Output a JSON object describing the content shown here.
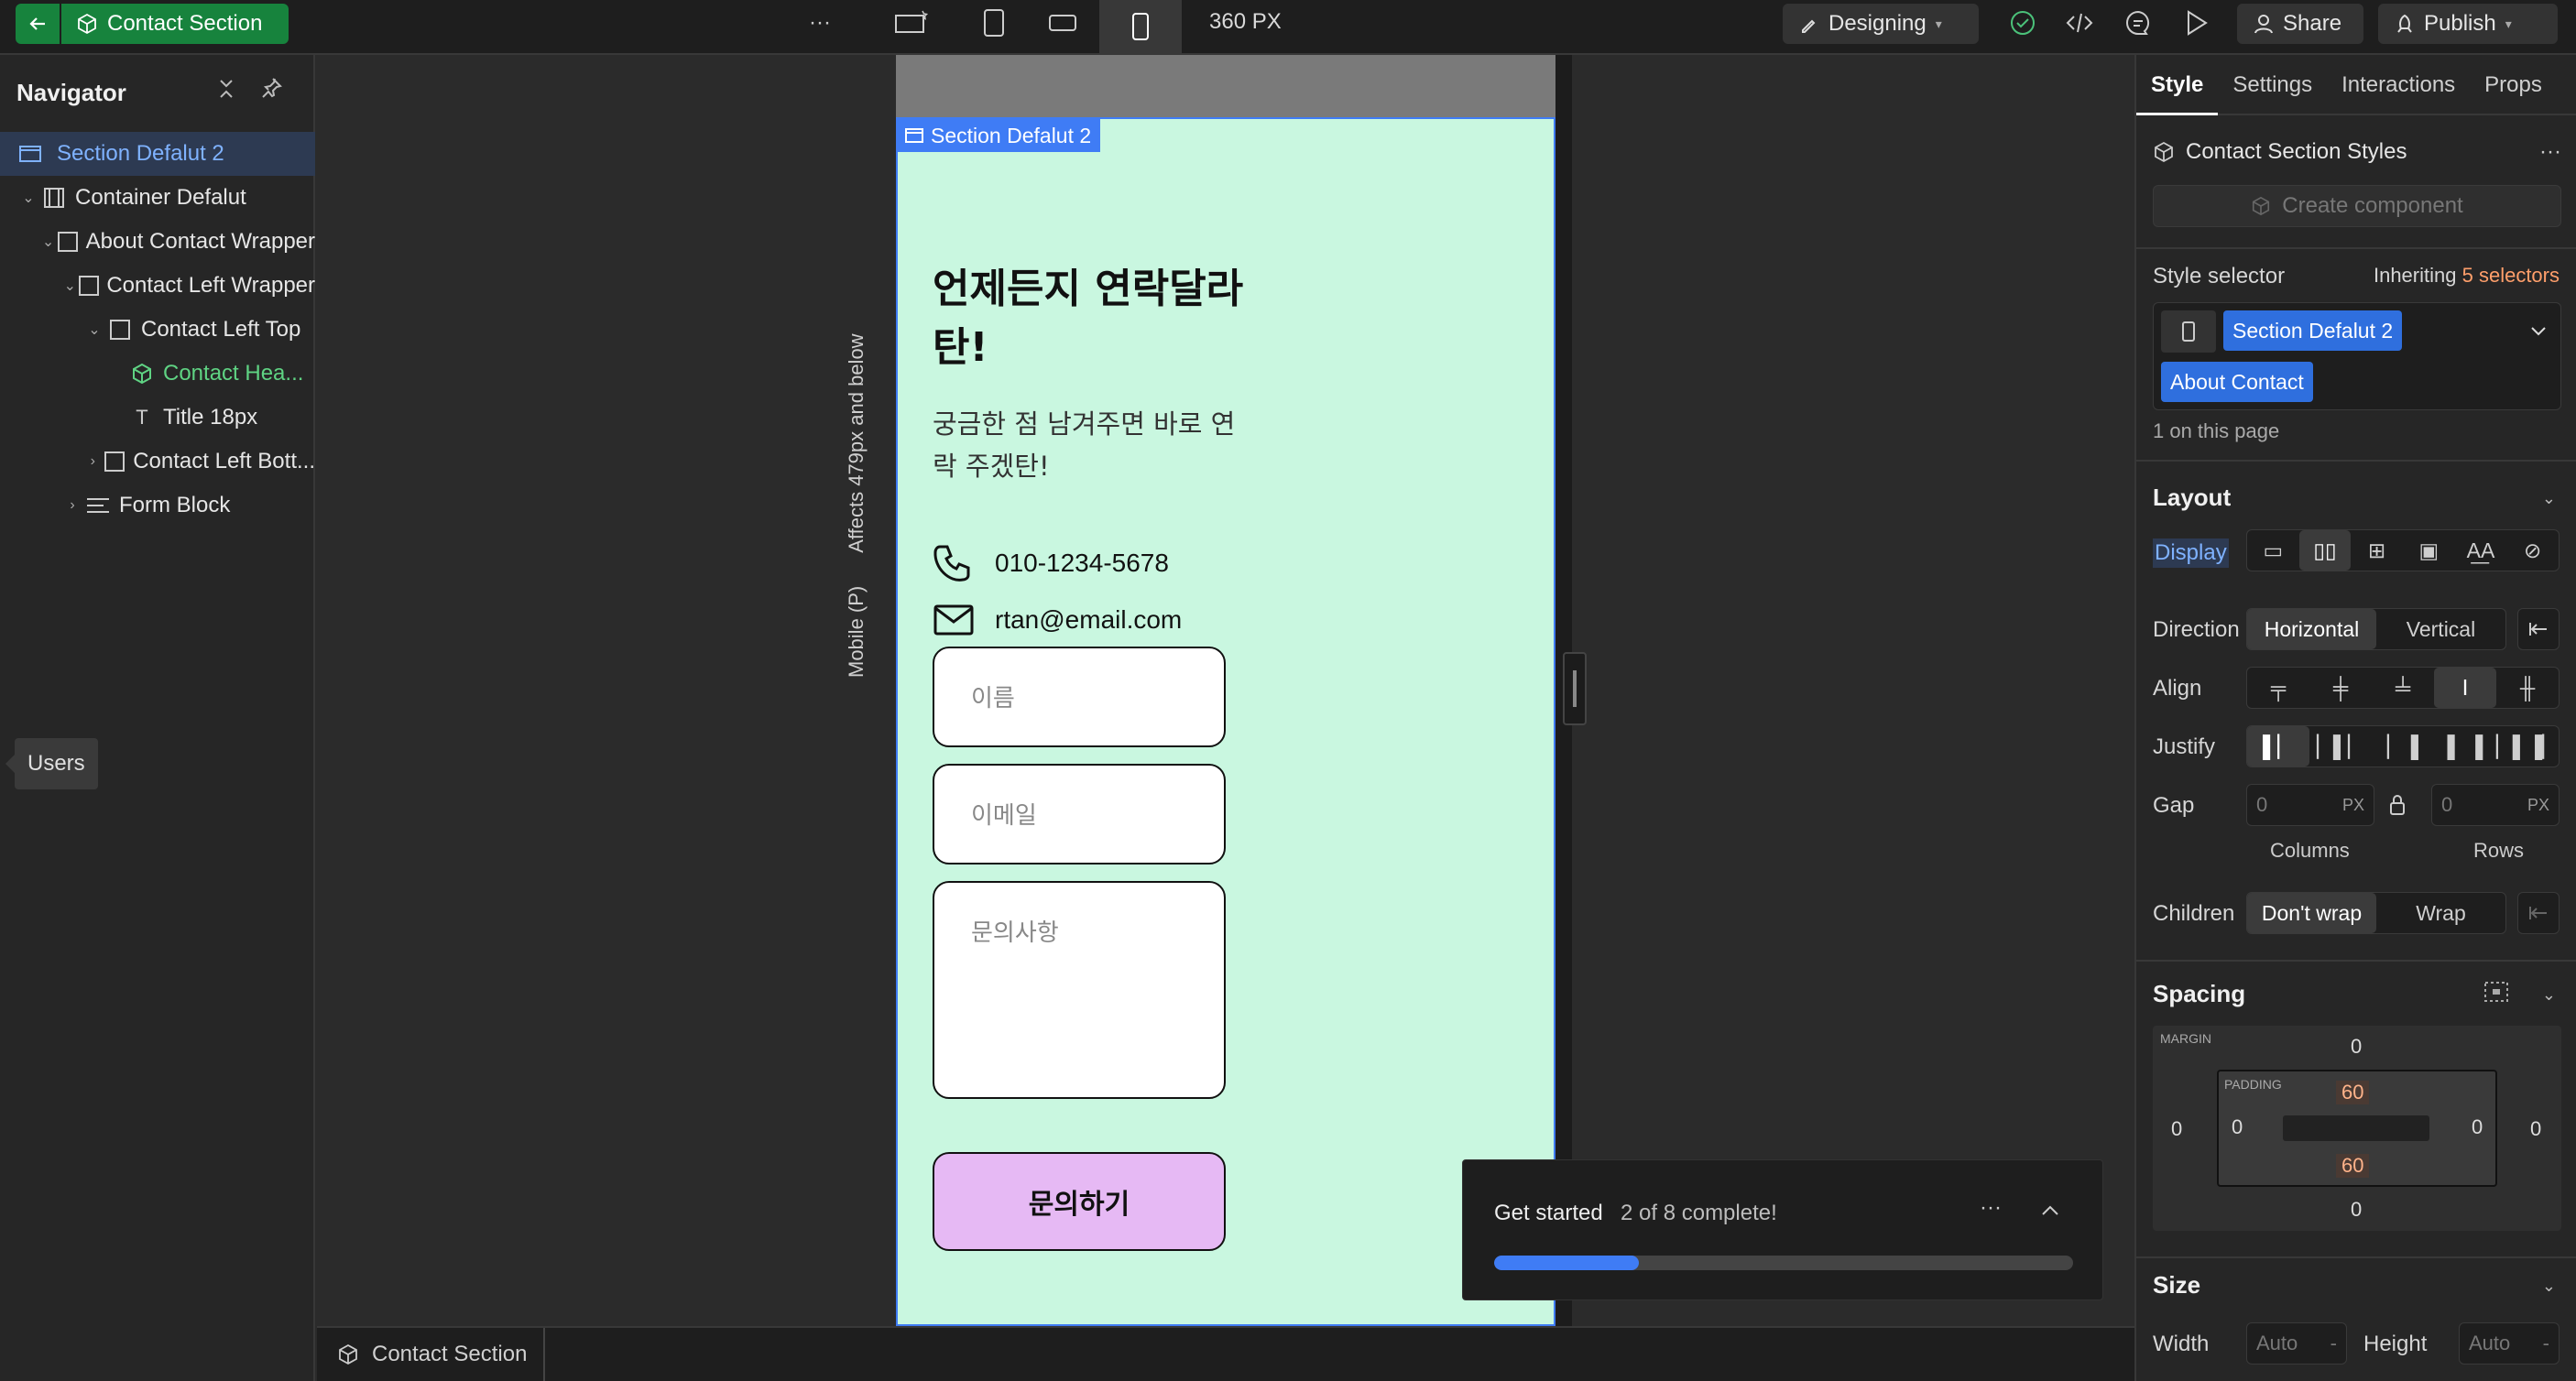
{
  "topbar": {
    "component_label": "Contact Section",
    "width_label": "360 PX",
    "mode_label": "Designing",
    "share_label": "Share",
    "publish_label": "Publish",
    "more_label": "···"
  },
  "navigator": {
    "title": "Navigator",
    "items": [
      {
        "label": "Section Defalut 2"
      },
      {
        "label": "Container Defalut"
      },
      {
        "label": "About Contact Wrapper"
      },
      {
        "label": "Contact Left Wrapper"
      },
      {
        "label": "Contact Left Top"
      },
      {
        "label": "Contact Hea..."
      },
      {
        "label": "Title 18px"
      },
      {
        "label": "Contact Left Bott..."
      },
      {
        "label": "Form Block"
      }
    ],
    "users_tooltip": "Users"
  },
  "canvas": {
    "selected_label": "Section Defalut 2",
    "breakpoint_note": "Affects 479px and below",
    "breakpoint_name": "Mobile (P)",
    "title": "언제든지 연락달라탄!",
    "subtitle": "궁금한 점 남겨주면 바로 연락 주겠탄!",
    "phone": "010-1234-5678",
    "email": "rtan@email.com",
    "name_placeholder": "이름",
    "email_placeholder": "이메일",
    "message_placeholder": "문의사항",
    "submit_label": "문의하기"
  },
  "get_started": {
    "title": "Get started",
    "count": "2 of 8 complete!",
    "progress": 0.25
  },
  "breadcrumb": {
    "label": "Contact Section"
  },
  "panel": {
    "tabs": [
      "Style",
      "Settings",
      "Interactions",
      "Props"
    ],
    "styles_title": "Contact Section Styles",
    "create_component": "Create component",
    "style_selector_label": "Style selector",
    "inheriting_prefix": "Inheriting",
    "inheriting_count": "5 selectors",
    "selector_tags": [
      "Section Defalut 2",
      "About Contact"
    ],
    "on_page": "1 on this page",
    "layout": {
      "title": "Layout",
      "display_label": "Display",
      "display_options": [
        "▭",
        "▯▯",
        "⊞",
        "▣",
        "A͟A",
        "⊘"
      ],
      "direction_label": "Direction",
      "direction_options": [
        "Horizontal",
        "Vertical"
      ],
      "align_label": "Align",
      "justify_label": "Justify",
      "gap_label": "Gap",
      "gap_columns": "0",
      "gap_rows": "0",
      "gap_unit": "PX",
      "columns_label": "Columns",
      "rows_label": "Rows",
      "children_label": "Children",
      "children_options": [
        "Don't wrap",
        "Wrap"
      ]
    },
    "spacing": {
      "title": "Spacing",
      "margin_label": "MARGIN",
      "padding_label": "PADDING",
      "margin": {
        "top": "0",
        "right": "0",
        "bottom": "0",
        "left": "0"
      },
      "padding": {
        "top": "60",
        "right": "0",
        "bottom": "60",
        "left": "0"
      }
    },
    "size": {
      "title": "Size",
      "width_label": "Width",
      "height_label": "Height",
      "width_value": "Auto",
      "height_value": "Auto",
      "unit": "-"
    }
  },
  "colors": {
    "accent_green": "#17833d",
    "accent_blue": "#3f7cf5",
    "canvas_bg": "#c9f7e0",
    "button_bg": "#e6b9f4"
  }
}
